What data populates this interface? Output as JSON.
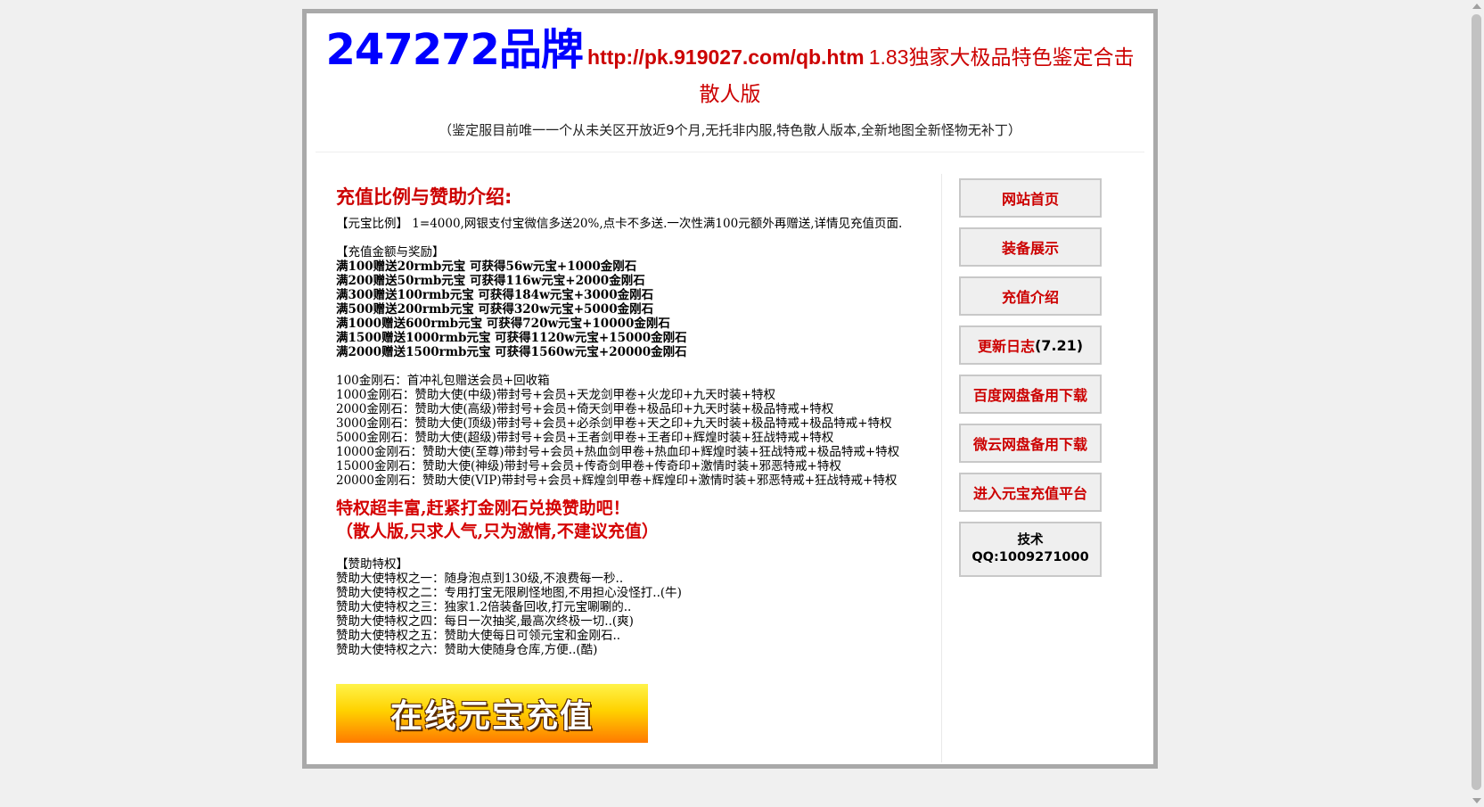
{
  "header": {
    "brand": "247272品牌",
    "url": "http://pk.919027.com/qb.htm",
    "tagline": "1.83独家大极品特色鉴定合击散人版",
    "subline": "（鉴定服目前唯一一个从未关区开放近9个月,无托非内服,特色散人版本,全新地图全新怪物无补丁）"
  },
  "recharge": {
    "heading": "充值比例与赞助介绍:",
    "ratio_line": "【元宝比例】 1=4000,网银支付宝微信多送20%,点卡不多送.一次性满100元额外再赠送,详情见充值页面.",
    "bonus_title": "【充值金额与奖励】",
    "bonus_items": [
      "满100赠送20rmb元宝  可获得56w元宝+1000金刚石",
      "满200赠送50rmb元宝  可获得116w元宝+2000金刚石",
      "满300赠送100rmb元宝  可获得184w元宝+3000金刚石",
      "满500赠送200rmb元宝  可获得320w元宝+5000金刚石",
      "满1000赠送600rmb元宝  可获得720w元宝+10000金刚石",
      "满1500赠送1000rmb元宝  可获得1120w元宝+15000金刚石",
      "满2000赠送1500rmb元宝  可获得1560w元宝+20000金刚石"
    ],
    "diamond_items": [
      "100金刚石：首冲礼包赠送会员+回收箱",
      "1000金刚石：赞助大使(中级)带封号+会员+天龙剑甲卷+火龙印+九天时装+特权",
      "2000金刚石：赞助大使(高级)带封号+会员+倚天剑甲卷+极品印+九天时装+极品特戒+特权",
      "3000金刚石：赞助大使(顶级)带封号+会员+必杀剑甲卷+天之印+九天时装+极品特戒+极品特戒+特权",
      "5000金刚石：赞助大使(超级)带封号+会员+王者剑甲卷+王者印+辉煌时装+狂战特戒+特权",
      "10000金刚石：赞助大使(至尊)带封号+会员+热血剑甲卷+热血印+辉煌时装+狂战特戒+极品特戒+特权",
      "15000金刚石：赞助大使(神级)带封号+会员+传奇剑甲卷+传奇印+激情时装+邪恶特戒+特权",
      "20000金刚石：赞助大使(VIP)带封号+会员+辉煌剑甲卷+辉煌印+激情时装+邪恶特戒+狂战特戒+特权"
    ],
    "promo_line1": "特权超丰富,赶紧打金刚石兑换赞助吧！",
    "promo_line2": "（散人版,只求人气,只为激情,不建议充值）",
    "privilege_title": "【赞助特权】",
    "privilege_items": [
      "赞助大使特权之一：随身泡点到130级,不浪费每一秒..",
      "赞助大使特权之二：专用打宝无限刷怪地图,不用担心没怪打..(牛)",
      "赞助大使特权之三：独家1.2倍装备回收,打元宝唰唰的..",
      "赞助大使特权之四：每日一次抽奖,最高次终极一切..(爽)",
      "赞助大使特权之五：赞助大使每日可领元宝和金刚石..",
      "赞助大使特权之六：赞助大使随身仓库,方便..(酷)"
    ],
    "banner_label": "在线元宝充值"
  },
  "nav": {
    "items": [
      {
        "label": "网站首页"
      },
      {
        "label": "装备展示"
      },
      {
        "label": "充值介绍"
      },
      {
        "label": "更新日志",
        "suffix": "(7.21)"
      },
      {
        "label": "百度网盘备用下载"
      },
      {
        "label": "微云网盘备用下载"
      },
      {
        "label": "进入元宝充值平台"
      }
    ],
    "tech_label": "技术",
    "tech_qq": "QQ:1009271000"
  },
  "colors": {
    "brand_blue": "#0000ff",
    "accent_red": "#cc0000",
    "frame_gray": "#a9a9a9",
    "button_bg": "#efefef"
  }
}
